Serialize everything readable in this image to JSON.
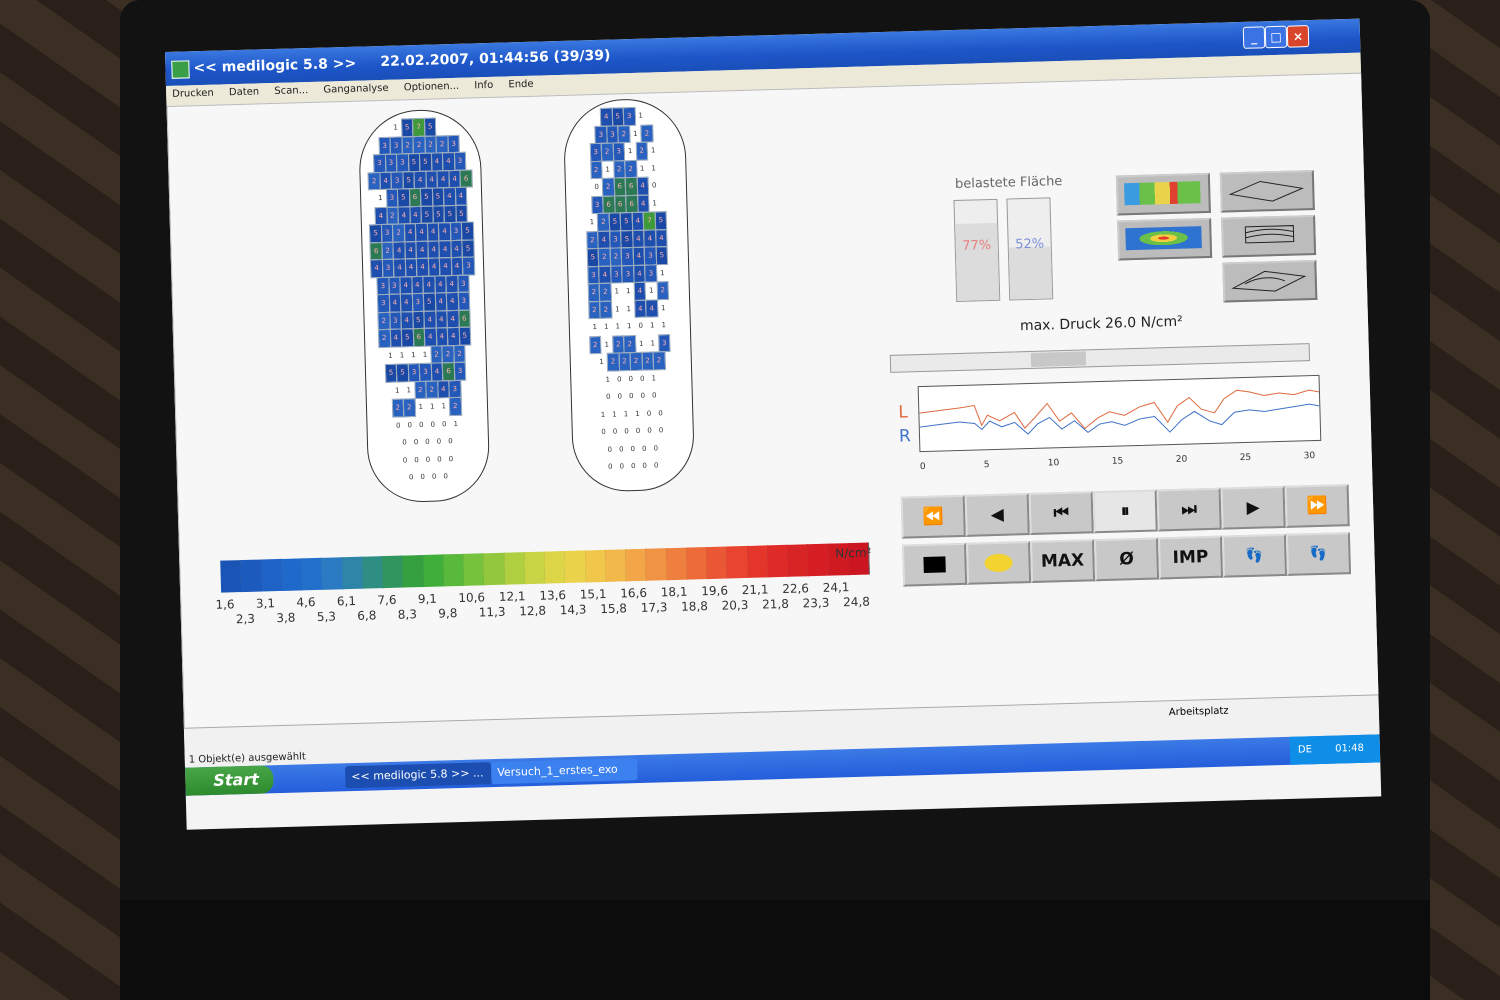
{
  "window": {
    "title": "<< medilogic 5.8 >>",
    "timestamp": "22.02.2007, 01:44:56 (39/39)"
  },
  "menu": [
    "Drucken",
    "Daten",
    "Scan...",
    "Ganganalyse",
    "Optionen...",
    "Info",
    "Ende"
  ],
  "left_foot_rows": [
    [
      "1",
      "5",
      "7",
      "5",
      ""
    ],
    [
      "3",
      "3",
      "2",
      "2",
      "2",
      "2",
      "3"
    ],
    [
      "3",
      "3",
      "3",
      "5",
      "5",
      "4",
      "4",
      "3"
    ],
    [
      "2",
      "4",
      "3",
      "5",
      "4",
      "4",
      "4",
      "4",
      "6"
    ],
    [
      "1",
      "3",
      "5",
      "6",
      "5",
      "5",
      "4",
      "4"
    ],
    [
      "4",
      "2",
      "4",
      "4",
      "5",
      "5",
      "5",
      "5"
    ],
    [
      "5",
      "3",
      "2",
      "4",
      "4",
      "4",
      "4",
      "3",
      "5"
    ],
    [
      "6",
      "2",
      "4",
      "4",
      "4",
      "4",
      "4",
      "4",
      "5"
    ],
    [
      "4",
      "3",
      "4",
      "4",
      "4",
      "4",
      "4",
      "4",
      "3"
    ],
    [
      "3",
      "3",
      "4",
      "4",
      "4",
      "4",
      "4",
      "3"
    ],
    [
      "3",
      "4",
      "4",
      "3",
      "5",
      "4",
      "4",
      "3"
    ],
    [
      "2",
      "3",
      "4",
      "5",
      "4",
      "4",
      "4",
      "6"
    ],
    [
      "2",
      "4",
      "5",
      "6",
      "4",
      "4",
      "4",
      "5"
    ],
    [
      "1",
      "1",
      "1",
      "1",
      "2",
      "2",
      "2"
    ],
    [
      "5",
      "5",
      "3",
      "3",
      "4",
      "6",
      "3"
    ],
    [
      "1",
      "1",
      "2",
      "2",
      "4",
      "3"
    ],
    [
      "2",
      "2",
      "1",
      "1",
      "1",
      "2"
    ],
    [
      "0",
      "0",
      "0",
      "0",
      "0",
      "1"
    ],
    [
      "0",
      "0",
      "0",
      "0",
      "0"
    ],
    [
      "0",
      "0",
      "0",
      "0",
      "0"
    ],
    [
      "0",
      "0",
      "0",
      "0"
    ]
  ],
  "right_foot_rows": [
    [
      "4",
      "5",
      "3",
      "1"
    ],
    [
      "3",
      "3",
      "2",
      "1",
      "2"
    ],
    [
      "3",
      "2",
      "3",
      "1",
      "2",
      "1"
    ],
    [
      "2",
      "1",
      "2",
      "2",
      "1",
      "1"
    ],
    [
      "0",
      "2",
      "6",
      "6",
      "4",
      "0"
    ],
    [
      "3",
      "6",
      "6",
      "6",
      "4",
      "1"
    ],
    [
      "1",
      "2",
      "5",
      "5",
      "4",
      "7",
      "5"
    ],
    [
      "2",
      "4",
      "3",
      "5",
      "4",
      "4",
      "4"
    ],
    [
      "5",
      "2",
      "2",
      "3",
      "4",
      "3",
      "5"
    ],
    [
      "3",
      "4",
      "3",
      "3",
      "4",
      "3",
      "1"
    ],
    [
      "2",
      "2",
      "1",
      "1",
      "4",
      "1",
      "2"
    ],
    [
      "2",
      "2",
      "1",
      "1",
      "4",
      "4",
      "1"
    ],
    [
      "1",
      "1",
      "1",
      "1",
      "0",
      "1",
      "1"
    ],
    [
      "2",
      "1",
      "2",
      "2",
      "1",
      "1",
      "3"
    ],
    [
      "1",
      "2",
      "2",
      "2",
      "2",
      "2"
    ],
    [
      "1",
      "0",
      "0",
      "0",
      "1"
    ],
    [
      "0",
      "0",
      "0",
      "0",
      "0"
    ],
    [
      "1",
      "1",
      "1",
      "1",
      "0",
      "0"
    ],
    [
      "0",
      "0",
      "0",
      "0",
      "0",
      "0"
    ],
    [
      "0",
      "0",
      "0",
      "0",
      "0"
    ],
    [
      "0",
      "0",
      "0",
      "0",
      "0"
    ]
  ],
  "colorscale": {
    "unit": "N/cm²",
    "ticks_top": [
      "1,6",
      "3,1",
      "4,6",
      "6,1",
      "7,6",
      "9,1",
      "10,6",
      "12,1",
      "13,6",
      "15,1",
      "16,6",
      "18,1",
      "19,6",
      "21,1",
      "22,6",
      "24,1"
    ],
    "ticks_bottom": [
      "2,3",
      "3,8",
      "5,3",
      "6,8",
      "8,3",
      "9,8",
      "11,3",
      "12,8",
      "14,3",
      "15,8",
      "17,3",
      "18,8",
      "20,3",
      "21,8",
      "23,3",
      "24,8"
    ],
    "colors": [
      "#1a55b5",
      "#1c5bbd",
      "#1d62c4",
      "#1f69ca",
      "#2270cc",
      "#2a7bc2",
      "#2d86a8",
      "#2f8e84",
      "#31955e",
      "#35a040",
      "#40ae3a",
      "#58b93a",
      "#76c23c",
      "#93c83e",
      "#afcf40",
      "#c8d443",
      "#dcd547",
      "#ead24b",
      "#f0c74b",
      "#f3b84a",
      "#f2a647",
      "#f09343",
      "#ee7f3e",
      "#ec6b39",
      "#ea5734",
      "#e8442f",
      "#e4352b",
      "#df2b28",
      "#d92426",
      "#d51f24",
      "#d01a22",
      "#cb1520"
    ]
  },
  "panel": {
    "belastete_label": "belastete Fläche",
    "left_pct_text": "77%",
    "left_pct_value": 77,
    "right_pct_text": "52%",
    "right_pct_value": 52,
    "left_color": "#e58080",
    "right_color": "#7a90d8",
    "max_druck": "max. Druck 26.0 N/cm²"
  },
  "graph": {
    "label_l": "L",
    "label_r": "R",
    "color_l": "#e06a40",
    "color_r": "#3f72c9",
    "axis_ticks": [
      "0",
      "5",
      "10",
      "15",
      "20",
      "25",
      "30"
    ]
  },
  "controls": {
    "row1": [
      "⏪",
      "◀",
      "⏮",
      "⏸",
      "⏭",
      "▶",
      "⏩"
    ],
    "row2_max": "MAX",
    "row2_avg": "Ø",
    "row2_imp": "IMP"
  },
  "status": {
    "arbeitsplatz": "Arbeitsplatz",
    "objekt": "1 Objekt(e) ausgewählt"
  },
  "taskbar": {
    "start": "Start",
    "task1": "<< medilogic 5.8 >> ...",
    "task2": "Versuch_1_erstes_exo",
    "lang": "DE",
    "clock": "01:48"
  }
}
